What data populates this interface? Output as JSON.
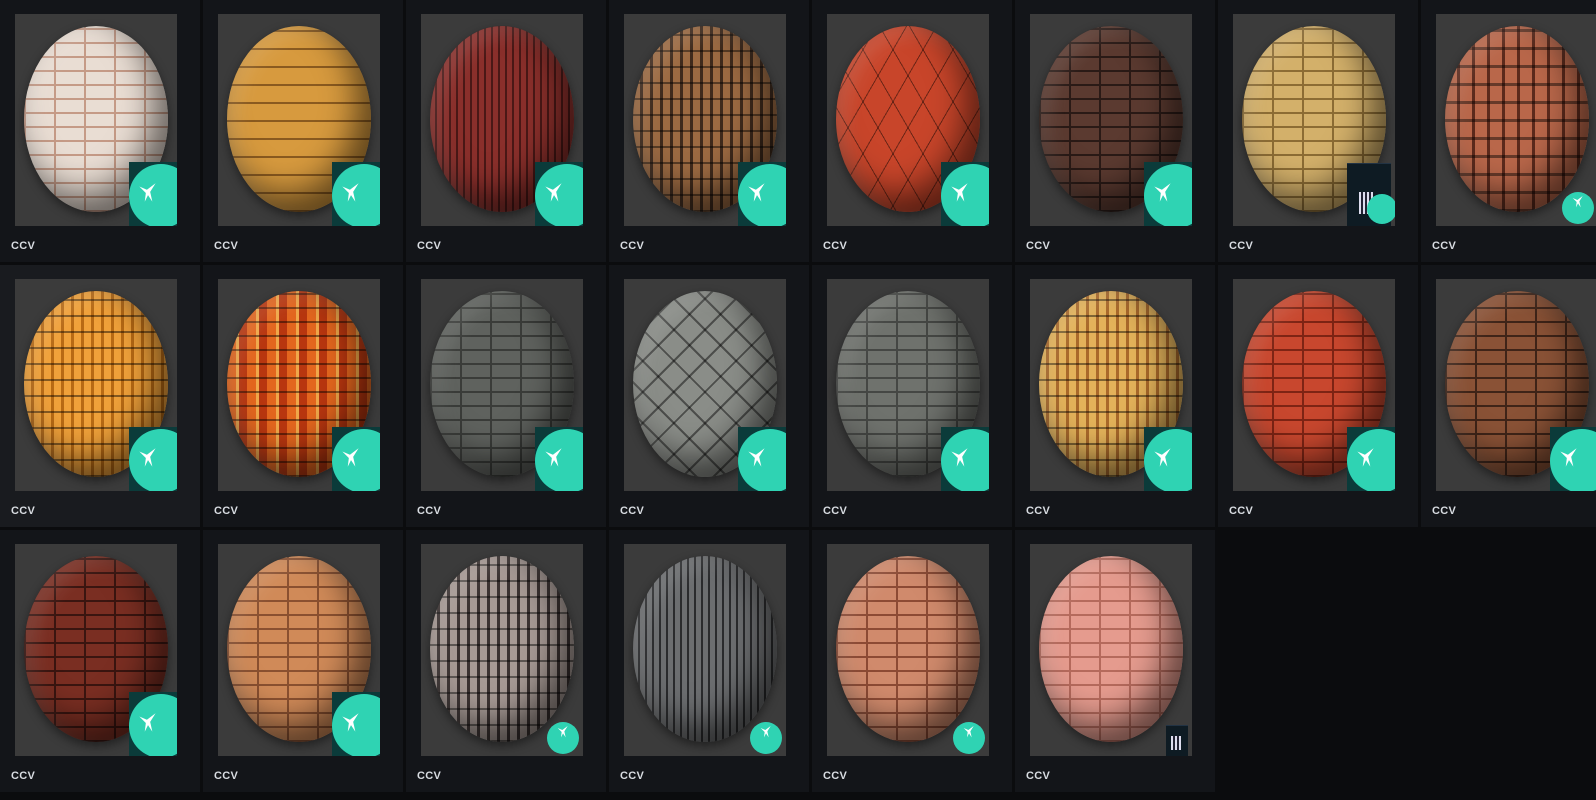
{
  "gallery": {
    "items": [
      {
        "label": "CCV",
        "material": "white-washed-brick",
        "badge": "teal-logo",
        "colors": [
          "#e9ddd3",
          "#c59a86"
        ]
      },
      {
        "label": "CCV",
        "material": "orange-slate-rows",
        "badge": "teal-logo",
        "colors": [
          "#d79a3e",
          "#8a5a1f"
        ]
      },
      {
        "label": "CCV",
        "material": "red-vertical-shingles",
        "badge": "teal-logo",
        "colors": [
          "#8a2f2b",
          "#4a1816"
        ]
      },
      {
        "label": "CCV",
        "material": "weathered-scale-roof",
        "badge": "teal-logo",
        "colors": [
          "#9c6a42",
          "#3f2a1c"
        ]
      },
      {
        "label": "CCV",
        "material": "red-hexagon-shingles",
        "badge": "teal-logo",
        "colors": [
          "#c8452a",
          "#7a2012"
        ]
      },
      {
        "label": "CCV",
        "material": "dark-brown-brick",
        "badge": "teal-logo",
        "colors": [
          "#5b3a30",
          "#2a1a16"
        ]
      },
      {
        "label": "CCV",
        "material": "straw-yellow-tiles",
        "badge": "qr-badge",
        "colors": [
          "#d3b06a",
          "#8c6c34"
        ]
      },
      {
        "label": "CCV",
        "material": "terracotta-pan-tiles",
        "badge": "teal-logo-small",
        "colors": [
          "#b9674a",
          "#5c2a1c"
        ]
      },
      {
        "label": "CCV",
        "material": "orange-barrel-tiles",
        "badge": "teal-logo",
        "colors": [
          "#f0a13a",
          "#b86a14"
        ]
      },
      {
        "label": "CCV",
        "material": "orange-red-checker-tiles",
        "badge": "teal-logo",
        "colors": [
          "#e3661e",
          "#b8360f"
        ]
      },
      {
        "label": "CCV",
        "material": "grey-slate-rectangles",
        "badge": "teal-logo",
        "colors": [
          "#5f625e",
          "#3a3c39"
        ]
      },
      {
        "label": "CCV",
        "material": "grey-diamond-slate",
        "badge": "teal-logo",
        "colors": [
          "#8a8d88",
          "#545652"
        ]
      },
      {
        "label": "CCV",
        "material": "weathered-grey-slate",
        "badge": "teal-logo",
        "colors": [
          "#6f726d",
          "#454744"
        ]
      },
      {
        "label": "CCV",
        "material": "mixed-yellow-barrel-tiles",
        "badge": "teal-logo",
        "colors": [
          "#e3b25a",
          "#a9692a"
        ]
      },
      {
        "label": "CCV",
        "material": "red-clay-brick",
        "badge": "teal-logo",
        "colors": [
          "#c8472e",
          "#7e2414"
        ]
      },
      {
        "label": "CCV",
        "material": "mixed-brown-brick",
        "badge": "teal-logo",
        "colors": [
          "#8a5236",
          "#3f2418"
        ]
      },
      {
        "label": "CCV",
        "material": "dark-red-brick",
        "badge": "teal-logo",
        "colors": [
          "#7a2e22",
          "#3a1510"
        ]
      },
      {
        "label": "CCV",
        "material": "tan-orange-brick",
        "badge": "teal-logo",
        "colors": [
          "#d08a58",
          "#8a5030"
        ]
      },
      {
        "label": "CCV",
        "material": "speckled-scale-tiles",
        "badge": "teal-logo-small",
        "colors": [
          "#a79a95",
          "#3b3231"
        ]
      },
      {
        "label": "CCV",
        "material": "grey-wood-bark",
        "badge": "teal-logo-small",
        "colors": [
          "#6c6e70",
          "#2a2b2d"
        ]
      },
      {
        "label": "CCV",
        "material": "salmon-brick",
        "badge": "teal-logo-small",
        "colors": [
          "#d08a6c",
          "#8c4a34"
        ]
      },
      {
        "label": "CCV",
        "material": "pink-brick",
        "badge": "qr-badge-tiny",
        "colors": [
          "#e59b8e",
          "#b56a5c"
        ]
      }
    ]
  }
}
